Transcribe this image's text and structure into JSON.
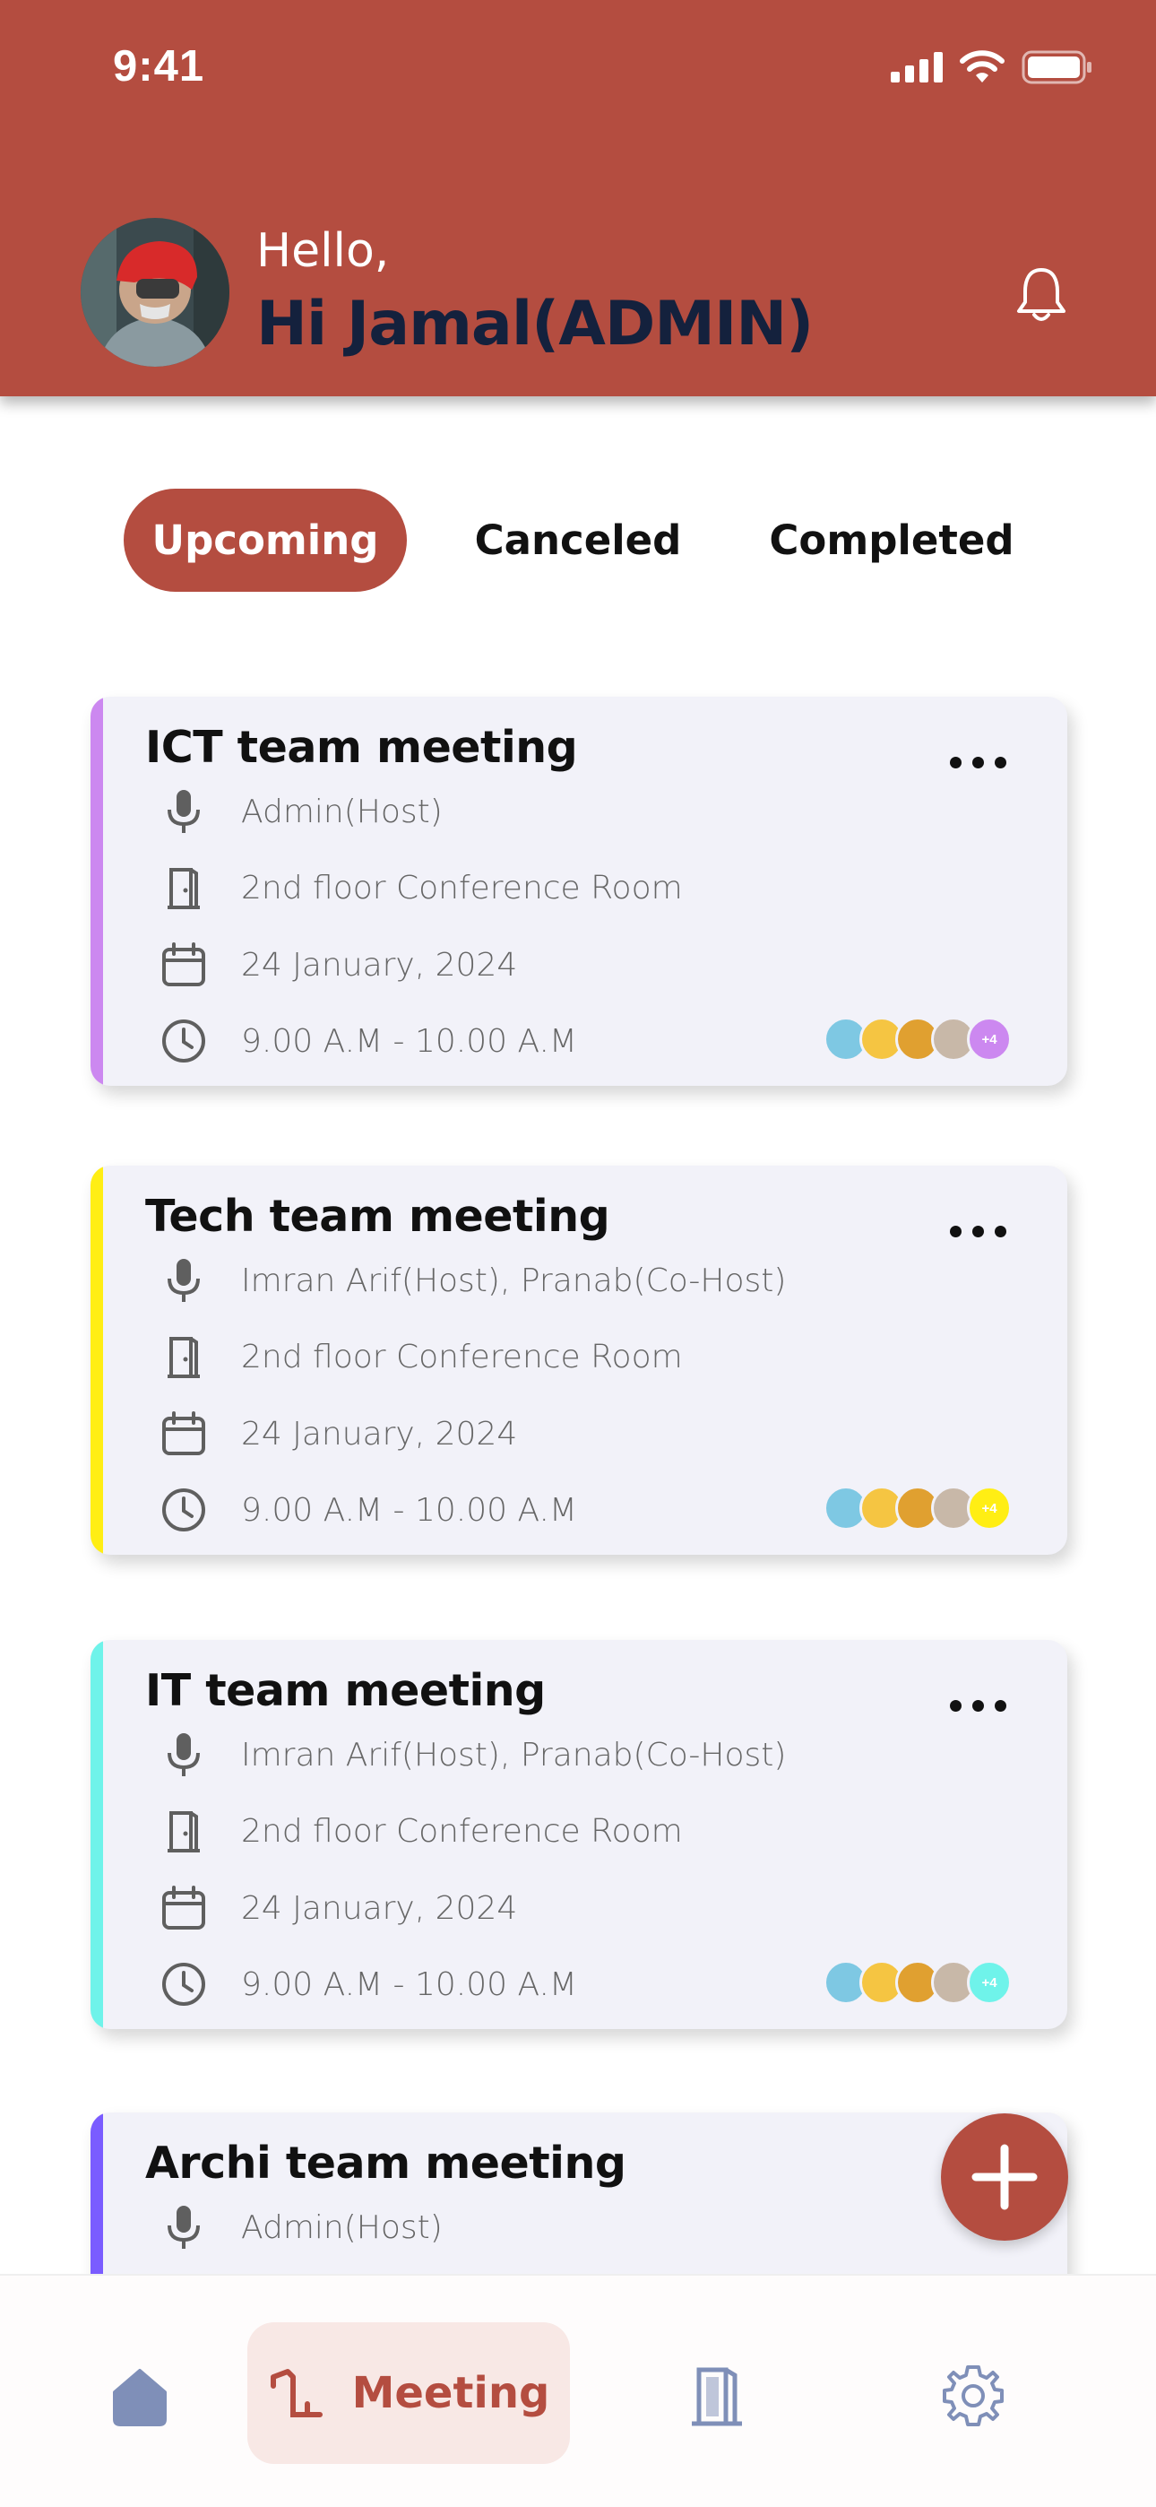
{
  "status_bar": {
    "time": "9:41"
  },
  "header": {
    "greeting": "Hello,",
    "name": "Hi Jamal(ADMIN)"
  },
  "tabs": [
    {
      "label": "Upcoming",
      "active": true
    },
    {
      "label": "Canceled",
      "active": false
    },
    {
      "label": "Completed",
      "active": false
    }
  ],
  "meetings": [
    {
      "title": "ICT team meeting",
      "host": "Admin(Host)",
      "room": "2nd floor Conference Room",
      "date": "24 January, 2024",
      "time": "9.00 A.M - 10.00 A.M",
      "accent": "#cc88f0",
      "extra": "+4"
    },
    {
      "title": "Tech team meeting",
      "host": "Imran Arif(Host), Pranab(Co-Host)",
      "room": "2nd floor Conference Room",
      "date": "24 January, 2024",
      "time": "9.00 A.M - 10.00 A.M",
      "accent": "#ffee14",
      "extra": "+4"
    },
    {
      "title": "IT team meeting",
      "host": "Imran Arif(Host), Pranab(Co-Host)",
      "room": "2nd floor Conference Room",
      "date": "24 January, 2024",
      "time": "9.00 A.M - 10.00 A.M",
      "accent": "#6ff3ea",
      "extra": "+4"
    },
    {
      "title": "Archi team meeting",
      "host": "Admin(Host)",
      "accent": "#7a5cff"
    }
  ],
  "bottom_nav": {
    "items": [
      {
        "name": "home",
        "icon": "home-icon"
      },
      {
        "name": "meeting",
        "icon": "meeting-icon",
        "label": "Meeting",
        "active": true
      },
      {
        "name": "rooms",
        "icon": "door-icon"
      },
      {
        "name": "settings",
        "icon": "gear-icon"
      }
    ]
  },
  "colors": {
    "primary": "#b44d40",
    "card_bg": "#f2f2f9",
    "nav_inactive": "#7f8fb8"
  }
}
